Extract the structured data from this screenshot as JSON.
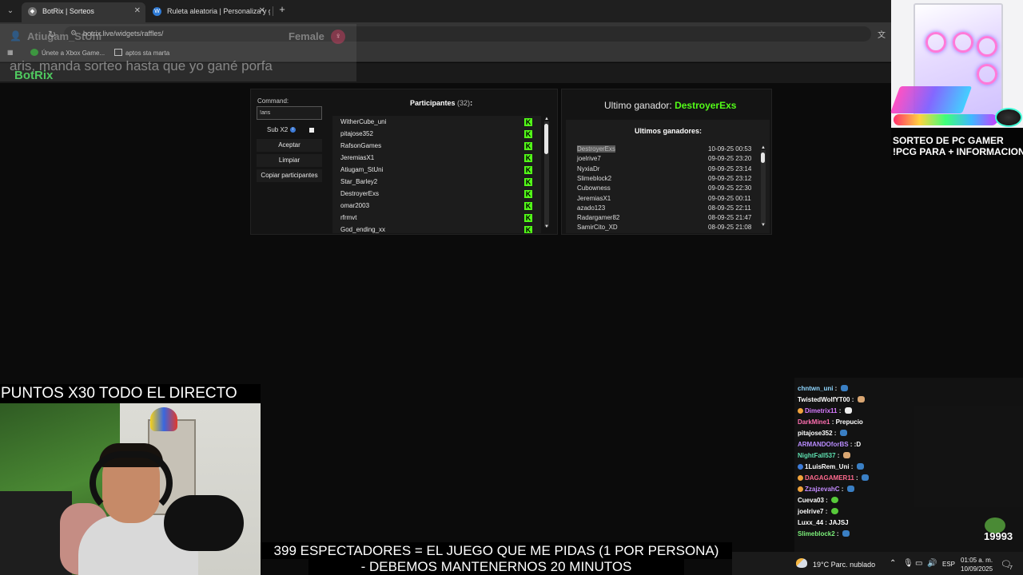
{
  "browser": {
    "tabs": [
      {
        "title": "BotRix | Sorteos",
        "active": true
      },
      {
        "title": "Ruleta aleatoria | Personaliza y gira",
        "active": false
      }
    ],
    "url": "botrix.live/widgets/raffles/",
    "bookmarks": [
      "Únete a Xbox Game...",
      "aptos sta marta"
    ]
  },
  "overlay": {
    "username": "Atiugam_StUni",
    "gender_label": "Female",
    "message": "aris, manda sorteo hasta que yo gané porfa",
    "brand": "BotRix"
  },
  "raffle": {
    "command_label": "Command:",
    "command_value": "!aris",
    "subx2_label": "Sub X2",
    "buttons": {
      "accept": "Aceptar",
      "clear": "Limpiar",
      "copy": "Copiar participantes"
    },
    "participants_title": "Participantes",
    "participants_count": "(32)",
    "participants_colon": ":",
    "participants": [
      "WitherCube_uni",
      "pitajose352",
      "RafsonGames",
      "JeremiasX1",
      "Atiugam_StUni",
      "Star_Barley2",
      "DestroyerExs",
      "omar2003",
      "rfrmvt",
      "God_ending_xx"
    ],
    "last_winner_label": "Ultimo ganador:",
    "last_winner": "DestroyerExs",
    "winners_title": "Ultimos ganadores:",
    "winners": [
      {
        "name": "DestroyerExs",
        "date": "10-09-25 00:53"
      },
      {
        "name": "joelrive7",
        "date": "09-09-25 23:20"
      },
      {
        "name": "NyxiaDr",
        "date": "09-09-25 23:14"
      },
      {
        "name": "Slimeblock2",
        "date": "09-09-25 23:12"
      },
      {
        "name": "Cubowness",
        "date": "09-09-25 22:30"
      },
      {
        "name": "JeremiasX1",
        "date": "09-09-25 00:11"
      },
      {
        "name": "azado123",
        "date": "08-09-25 22:11"
      },
      {
        "name": "Radargamer82",
        "date": "08-09-25 21:47"
      },
      {
        "name": "SamirCito_XD",
        "date": "08-09-25 21:08"
      }
    ]
  },
  "ad": {
    "line1": "SORTEO DE PC GAMER",
    "line2": "!PCG PARA + INFORMACION"
  },
  "stream": {
    "banner": "PUNTOS X30 TODO EL DIRECTO",
    "caption_line1": "399 ESPECTADORES = EL JUEGO QUE ME PIDAS (1 POR PERSONA)",
    "caption_line2": "- DEBEMOS MANTENERNOS 20 MINUTOS",
    "pepe_count": "19993"
  },
  "chat": [
    {
      "user": "chntwn_uni",
      "msg": "",
      "color": "#8fd6ff",
      "emote": "blue"
    },
    {
      "user": "TwistedWolfYT00",
      "msg": "",
      "color": "#ffffff",
      "emote": "cat"
    },
    {
      "user": "Dimetrix11",
      "msg": "",
      "color": "#d77bff",
      "emote": "ghost",
      "badge": "#f1a33b"
    },
    {
      "user": "DarkMine1",
      "msg": "Prepucio",
      "color": "#ff6fb1",
      "emote": ""
    },
    {
      "user": "pitajose352",
      "msg": "",
      "color": "#ffffff",
      "emote": "blue"
    },
    {
      "user": "ARMANDOforBS",
      "msg": ":D",
      "color": "#b98cff",
      "emote": ""
    },
    {
      "user": "NightFall537",
      "msg": "",
      "color": "#5ee0b0",
      "emote": "cat"
    },
    {
      "user": "1LuisRem_Uni",
      "msg": "",
      "color": "#ffffff",
      "emote": "blue",
      "badge": "#3d7bd8"
    },
    {
      "user": "DAGAGAMER11",
      "msg": "",
      "color": "#ff6a8e",
      "emote": "blue",
      "badge": "#f1a33b"
    },
    {
      "user": "ZzajzevahC",
      "msg": "",
      "color": "#c48bff",
      "emote": "blue",
      "badge": "#f1a33b"
    },
    {
      "user": "Cueva03",
      "msg": "",
      "color": "#ffffff",
      "emote": "green"
    },
    {
      "user": "joelrive7",
      "msg": "",
      "color": "#ffffff",
      "emote": "green"
    },
    {
      "user": "Luxx_44",
      "msg": "JAJSJ",
      "color": "#ffffff",
      "emote": ""
    },
    {
      "user": "Slimeblock2",
      "msg": "",
      "color": "#7cf07a",
      "emote": "blue"
    }
  ],
  "taskbar": {
    "weather": "19°C  Parc. nublado",
    "lang": "ESP",
    "time": "01:05 a. m.",
    "date": "10/09/2025",
    "notif_count": "7"
  },
  "colors": {
    "kick_green": "#53fc18",
    "brand_green": "#4fc95f"
  }
}
